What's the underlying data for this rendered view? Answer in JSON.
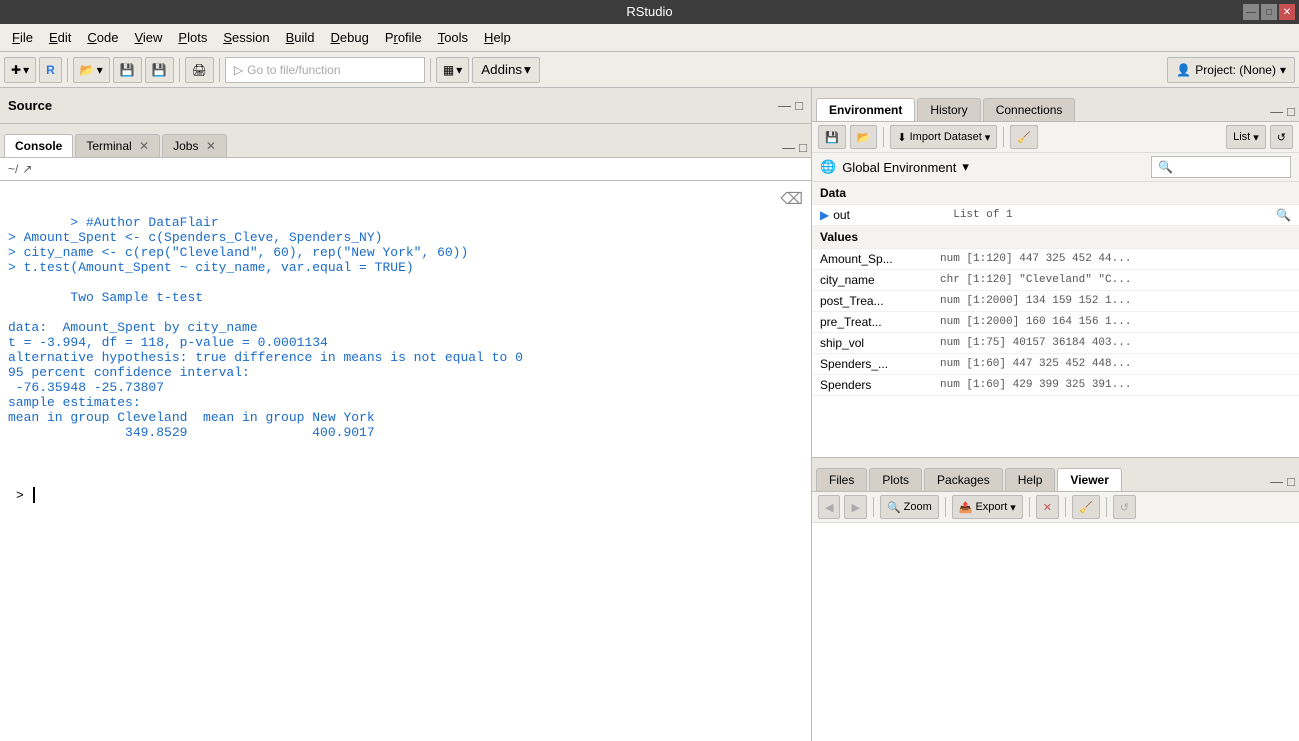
{
  "app": {
    "title": "RStudio"
  },
  "titlebar_controls": [
    "—",
    "□",
    "✕"
  ],
  "menubar": {
    "items": [
      {
        "label": "File",
        "key": "F"
      },
      {
        "label": "Edit",
        "key": "E"
      },
      {
        "label": "Code",
        "key": "C"
      },
      {
        "label": "View",
        "key": "V"
      },
      {
        "label": "Plots",
        "key": "P"
      },
      {
        "label": "Session",
        "key": "S"
      },
      {
        "label": "Build",
        "key": "B"
      },
      {
        "label": "Debug",
        "key": "D"
      },
      {
        "label": "Profile",
        "key": "r"
      },
      {
        "label": "Tools",
        "key": "T"
      },
      {
        "label": "Help",
        "key": "H"
      }
    ]
  },
  "toolbar": {
    "go_to_file_placeholder": "Go to file/function",
    "addins_label": "Addins",
    "project_label": "Project: (None)"
  },
  "source_panel": {
    "title": "Source"
  },
  "console": {
    "tabs": [
      {
        "label": "Console",
        "closeable": false
      },
      {
        "label": "Terminal",
        "closeable": true
      },
      {
        "label": "Jobs",
        "closeable": true
      }
    ],
    "path": "~/",
    "lines": [
      {
        "type": "cmd",
        "text": "> #Author DataFlair"
      },
      {
        "type": "cmd",
        "text": "> Amount_Spent <- c(Spenders_Cleve, Spenders_NY)"
      },
      {
        "type": "cmd",
        "text": "> city_name <- c(rep(\"Cleveland\", 60), rep(\"New York\", 60))"
      },
      {
        "type": "cmd",
        "text": "> t.test(Amount_Spent ~ city_name, var.equal = TRUE)"
      },
      {
        "type": "output",
        "text": ""
      },
      {
        "type": "output",
        "text": "\tTwo Sample t-test"
      },
      {
        "type": "output",
        "text": ""
      },
      {
        "type": "output",
        "text": "data:  Amount_Spent by city_name"
      },
      {
        "type": "output",
        "text": "t = -3.994, df = 118, p-value = 0.0001134"
      },
      {
        "type": "output",
        "text": "alternative hypothesis: true difference in means is not equal to 0"
      },
      {
        "type": "output",
        "text": "95 percent confidence interval:"
      },
      {
        "type": "output",
        "text": " -76.35948 -25.73807"
      },
      {
        "type": "output",
        "text": "sample estimates:"
      },
      {
        "type": "output",
        "text": "mean in group Cleveland  mean in group New York"
      },
      {
        "type": "output",
        "text": "               349.8529                400.9017"
      }
    ]
  },
  "environment": {
    "tabs": [
      {
        "label": "Environment",
        "active": true
      },
      {
        "label": "History",
        "active": false
      },
      {
        "label": "Connections",
        "active": false
      }
    ],
    "toolbar": {
      "import_dataset": "Import Dataset",
      "list_label": "List"
    },
    "global_env": "Global Environment",
    "sections": {
      "data": {
        "header": "Data",
        "items": [
          {
            "name": "out",
            "value": "List of 1",
            "has_arrow": true,
            "has_search": true
          }
        ]
      },
      "values": {
        "header": "Values",
        "items": [
          {
            "name": "Amount_Sp...",
            "value": "num [1:120] 447 325 452 44..."
          },
          {
            "name": "city_name",
            "value": "chr [1:120] \"Cleveland\" \"C..."
          },
          {
            "name": "post_Trea...",
            "value": "num [1:2000] 134 159 152 1..."
          },
          {
            "name": "pre_Treat...",
            "value": "num [1:2000] 160 164 156 1..."
          },
          {
            "name": "ship_vol",
            "value": "num [1:75] 40157 36184 403..."
          },
          {
            "name": "Spenders_...",
            "value": "num [1:60] 447 325 452 448..."
          },
          {
            "name": "Spenders",
            "value": "num [1:60] 429 399 325 391..."
          }
        ]
      }
    }
  },
  "bottom_panel": {
    "tabs": [
      {
        "label": "Files",
        "active": false
      },
      {
        "label": "Plots",
        "active": false
      },
      {
        "label": "Packages",
        "active": false
      },
      {
        "label": "Help",
        "active": false
      },
      {
        "label": "Viewer",
        "active": true
      }
    ],
    "toolbar": {
      "zoom": "Zoom",
      "export": "Export"
    }
  }
}
